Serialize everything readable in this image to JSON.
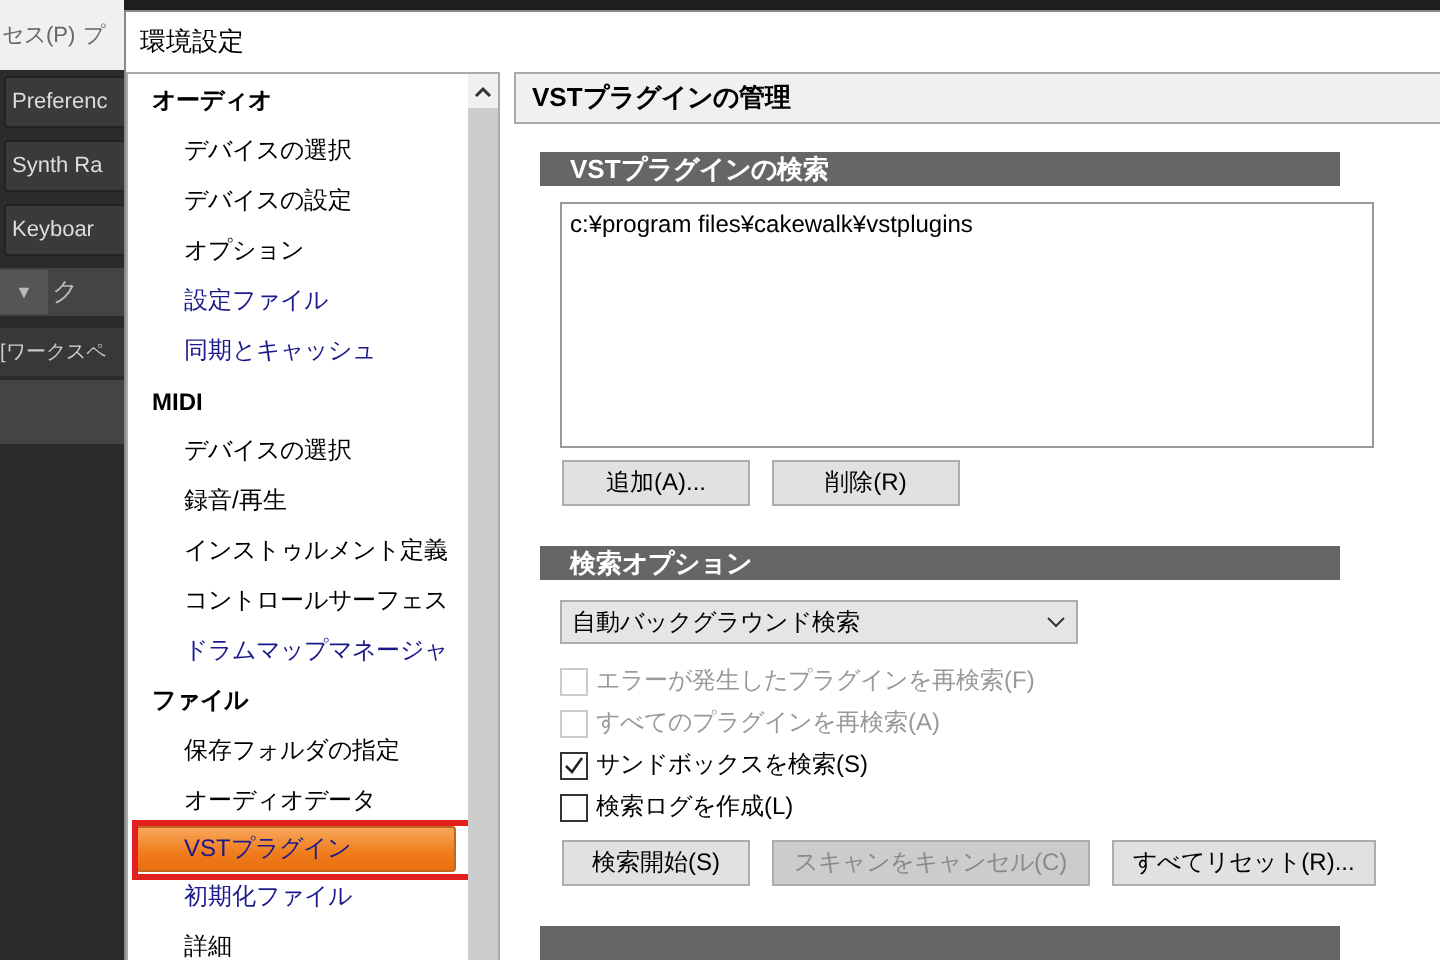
{
  "background_app": {
    "menu": [
      "セス(P)",
      "プ"
    ],
    "buttons": [
      "Preferenc",
      "Synth Ra",
      "Keyboar"
    ],
    "toolbar_caret": "▼",
    "toolbar_text": "ク",
    "workspace_text": "[ワークスペ"
  },
  "window": {
    "title": "環境設定"
  },
  "tree": [
    {
      "label": "オーディオ",
      "kind": "category",
      "selected": false,
      "annotated": false
    },
    {
      "label": "デバイスの選択",
      "kind": "item",
      "selected": false,
      "annotated": false
    },
    {
      "label": "デバイスの設定",
      "kind": "item",
      "selected": false,
      "annotated": false
    },
    {
      "label": "オプション",
      "kind": "item",
      "selected": false,
      "annotated": false
    },
    {
      "label": "設定ファイル",
      "kind": "link",
      "selected": false,
      "annotated": false
    },
    {
      "label": "同期とキャッシュ",
      "kind": "link",
      "selected": false,
      "annotated": false
    },
    {
      "label": "MIDI",
      "kind": "category",
      "selected": false,
      "annotated": false
    },
    {
      "label": "デバイスの選択",
      "kind": "item",
      "selected": false,
      "annotated": false
    },
    {
      "label": "録音/再生",
      "kind": "item",
      "selected": false,
      "annotated": false
    },
    {
      "label": "インストゥルメント定義",
      "kind": "item",
      "selected": false,
      "annotated": false
    },
    {
      "label": "コントロールサーフェス",
      "kind": "item",
      "selected": false,
      "annotated": false
    },
    {
      "label": "ドラムマップマネージャ",
      "kind": "link",
      "selected": false,
      "annotated": false
    },
    {
      "label": "ファイル",
      "kind": "category",
      "selected": false,
      "annotated": false
    },
    {
      "label": "保存フォルダの指定",
      "kind": "item",
      "selected": false,
      "annotated": false
    },
    {
      "label": "オーディオデータ",
      "kind": "item",
      "selected": false,
      "annotated": false
    },
    {
      "label": "VSTプラグイン",
      "kind": "link",
      "selected": true,
      "annotated": true
    },
    {
      "label": "初期化ファイル",
      "kind": "link",
      "selected": false,
      "annotated": false
    },
    {
      "label": "詳細",
      "kind": "item",
      "selected": false,
      "annotated": false
    }
  ],
  "page_title": "VSTプラグインの管理",
  "scan_section": {
    "title": "VSTプラグインの検索",
    "paths": [
      "c:¥program files¥cakewalk¥vstplugins"
    ],
    "buttons": [
      {
        "label": "追加(A)...",
        "disabled": false
      },
      {
        "label": "削除(R)",
        "disabled": false
      }
    ]
  },
  "options_section": {
    "title": "検索オプション",
    "mode_dropdown": {
      "value": "自動バックグラウンド検索"
    },
    "checkboxes": [
      {
        "label": "エラーが発生したプラグインを再検索(F)",
        "checked": false,
        "disabled": true
      },
      {
        "label": "すべてのプラグインを再検索(A)",
        "checked": false,
        "disabled": true
      },
      {
        "label": "サンドボックスを検索(S)",
        "checked": true,
        "disabled": false
      },
      {
        "label": "検索ログを作成(L)",
        "checked": false,
        "disabled": false
      }
    ],
    "buttons": [
      {
        "label": "検索開始(S)",
        "disabled": false
      },
      {
        "label": "スキャンをキャンセル(C)",
        "disabled": true
      },
      {
        "label": "すべてリセット(R)...",
        "disabled": false
      }
    ]
  }
}
